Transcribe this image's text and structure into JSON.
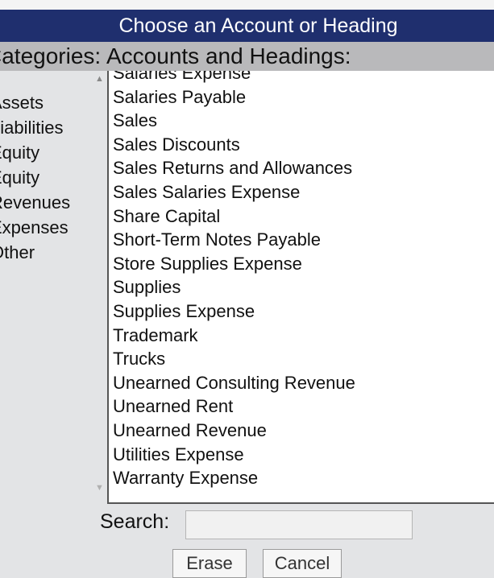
{
  "dialog": {
    "title": "Choose an Account or Heading"
  },
  "categories": {
    "header": "Categories:",
    "items": [
      "Assets",
      "Liabilities",
      "Equity",
      "Equity",
      "Revenues",
      "Expenses",
      "Other"
    ]
  },
  "accounts": {
    "header": "Accounts and Headings:",
    "items": [
      "Salaries Expense",
      "Salaries Payable",
      "Sales",
      "Sales Discounts",
      "Sales Returns and Allowances",
      "Sales Salaries Expense",
      "Share Capital",
      "Short-Term Notes Payable",
      "Store Supplies Expense",
      "Supplies",
      "Supplies Expense",
      "Trademark",
      "Trucks",
      "Unearned Consulting Revenue",
      "Unearned Rent",
      "Unearned Revenue",
      "Utilities Expense",
      "Warranty Expense"
    ]
  },
  "search": {
    "label": "Search:",
    "value": ""
  },
  "buttons": {
    "erase": "Erase",
    "cancel": "Cancel"
  },
  "icons": {
    "scroll_up": "triangle-up-icon",
    "scroll_down": "triangle-down-icon"
  },
  "colors": {
    "title_bar": "#1f2f6e",
    "header_bar": "#b9b9bb",
    "list_bg": "#ffffff",
    "page_bg": "#e3e4e6"
  }
}
